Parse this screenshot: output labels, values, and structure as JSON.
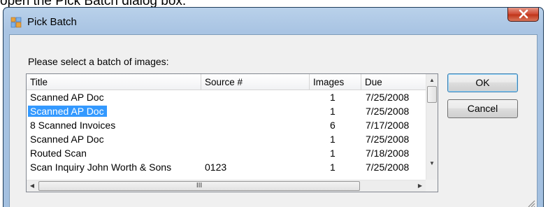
{
  "caption": "open the Pick Batch dialog box.",
  "window": {
    "title": "Pick Batch",
    "close_glyph": "X"
  },
  "dialog": {
    "prompt": "Please select a batch of images:",
    "columns": [
      "Title",
      "Source #",
      "Images",
      "Due"
    ],
    "rows": [
      {
        "title": "Scanned AP Doc",
        "source": "",
        "images": "1",
        "due": "7/25/2008",
        "selected": false
      },
      {
        "title": "Scanned AP Doc",
        "source": "",
        "images": "1",
        "due": "7/25/2008",
        "selected": true
      },
      {
        "title": "8 Scanned Invoices",
        "source": "",
        "images": "6",
        "due": "7/17/2008",
        "selected": false
      },
      {
        "title": "Scanned AP Doc",
        "source": "",
        "images": "1",
        "due": "7/25/2008",
        "selected": false
      },
      {
        "title": "Routed Scan",
        "source": "",
        "images": "1",
        "due": "7/18/2008",
        "selected": false
      },
      {
        "title": "Scan Inquiry John Worth & Sons",
        "source": "0123",
        "images": "1",
        "due": "7/25/2008",
        "selected": false
      }
    ],
    "ok_label": "OK",
    "cancel_label": "Cancel",
    "scroll": {
      "up": "▲",
      "down": "▼",
      "left": "◀",
      "right": "▶",
      "grip": "III"
    }
  },
  "colors": {
    "selection": "#3399ff",
    "close_button": "#c7432a",
    "title_bar": "#b9d1ea"
  },
  "icons": {
    "app": "window-app-icon",
    "close": "close-x-icon",
    "resize": "size-grip-icon"
  }
}
